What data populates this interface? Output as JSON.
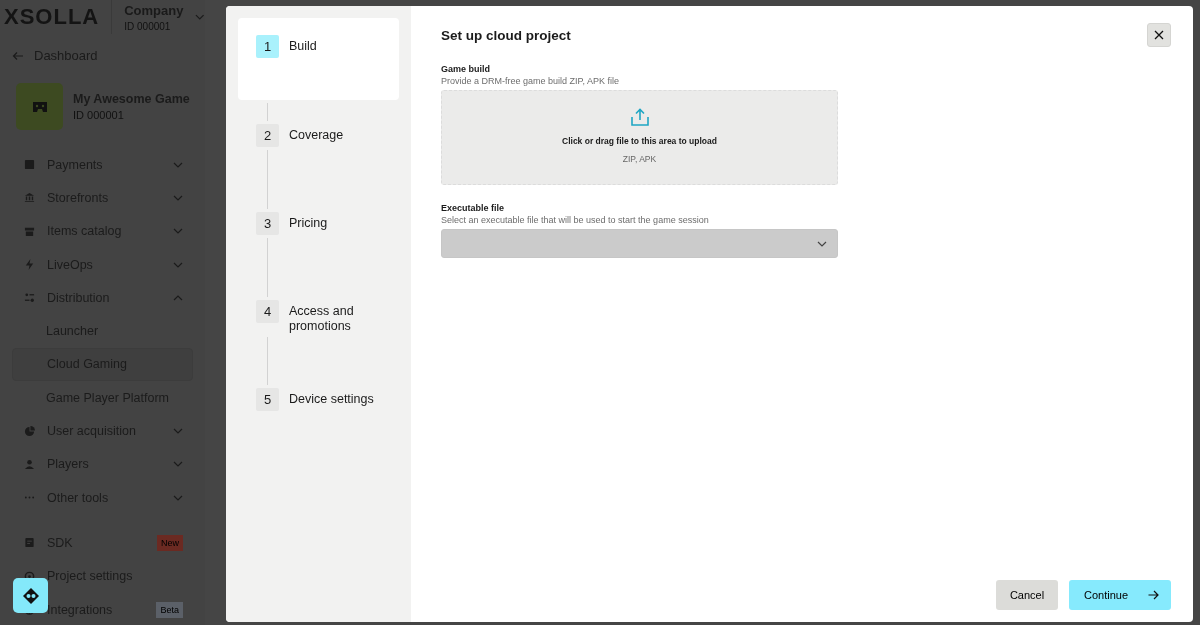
{
  "header": {
    "logo": "XSOLLA",
    "company": "Company",
    "company_id": "ID 000001"
  },
  "back_link": "Dashboard",
  "project": {
    "name": "My Awesome Game",
    "id": "ID 000001"
  },
  "sidebar": {
    "items": [
      {
        "kind": "nav",
        "label": "Payments",
        "expanded": false,
        "selected": false
      },
      {
        "kind": "nav",
        "label": "Storefronts",
        "expanded": false,
        "selected": false
      },
      {
        "kind": "nav",
        "label": "Items catalog",
        "expanded": false,
        "selected": false
      },
      {
        "kind": "nav",
        "label": "LiveOps",
        "expanded": false,
        "selected": false
      },
      {
        "kind": "nav",
        "label": "Distribution",
        "expanded": true,
        "selected": false
      },
      {
        "kind": "sub",
        "label": "Launcher",
        "selected": false
      },
      {
        "kind": "sub",
        "label": "Cloud Gaming",
        "selected": true
      },
      {
        "kind": "sub",
        "label": "Game Player Platform",
        "selected": false
      },
      {
        "kind": "nav",
        "label": "User acquisition",
        "expanded": false,
        "selected": false
      },
      {
        "kind": "nav",
        "label": "Players",
        "expanded": false,
        "selected": false
      },
      {
        "kind": "nav",
        "label": "Other tools",
        "expanded": false,
        "selected": false
      },
      {
        "kind": "link",
        "label": "SDK",
        "badge": "New",
        "color": "#6b2a22",
        "selected": false
      },
      {
        "kind": "link",
        "label": "Project settings",
        "selected": false
      },
      {
        "kind": "link",
        "label": "Integrations",
        "badge": "Beta",
        "color": "#5b6068",
        "selected": false
      }
    ]
  },
  "modal": {
    "steps": [
      {
        "number": "1",
        "label": "Build",
        "selected": true
      },
      {
        "number": "2",
        "label": "Coverage",
        "selected": false
      },
      {
        "number": "3",
        "label": "Pricing",
        "selected": false
      },
      {
        "number": "4",
        "label": "Access and promotions",
        "selected": false
      },
      {
        "number": "5",
        "label": "Device settings",
        "selected": false
      }
    ],
    "title": "Set up cloud project",
    "game_build": {
      "label": "Game build",
      "hint": "Provide a DRM-free game build ZIP, APK file",
      "upload_text": "Click or drag file to this area to upload",
      "formats": "ZIP, APK"
    },
    "executable": {
      "label": "Executable file",
      "hint": "Select an executable file that will be used to start the game session",
      "disabled": true
    },
    "buttons": {
      "cancel": "Cancel",
      "continue": "Continue"
    }
  }
}
